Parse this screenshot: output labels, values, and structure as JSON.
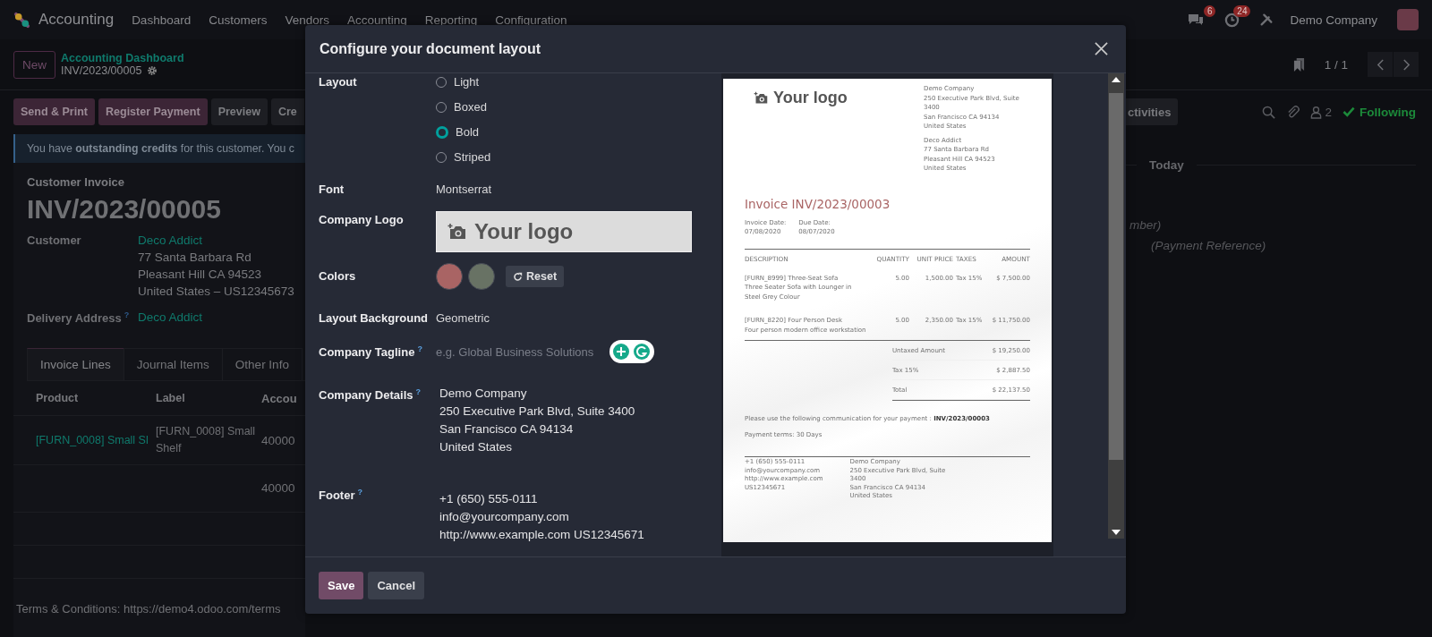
{
  "navbar": {
    "app_name": "Accounting",
    "menu": [
      "Dashboard",
      "Customers",
      "Vendors",
      "Accounting",
      "Reporting",
      "Configuration"
    ],
    "messages_badge": "6",
    "activities_badge": "24",
    "company": "Demo Company"
  },
  "control_panel": {
    "new_button": "New",
    "breadcrumb": "Accounting Dashboard",
    "record": "INV/2023/00005",
    "pager": "1 / 1"
  },
  "actions": {
    "buttons": [
      {
        "label": "Send & Print",
        "kind": "primary"
      },
      {
        "label": "Register Payment",
        "kind": "primary"
      },
      {
        "label": "Preview",
        "kind": "secondary"
      },
      {
        "label": "Cre",
        "kind": "secondary"
      }
    ]
  },
  "alert": "You have **outstanding credits** for this customer. You c",
  "form": {
    "type_label": "Customer Invoice",
    "number": "INV/2023/00005",
    "customer_label": "Customer",
    "customer": "Deco Addict",
    "address": [
      "77 Santa Barbara Rd",
      "Pleasant Hill CA 94523",
      "United States – US12345673"
    ],
    "delivery_label": "Delivery Address",
    "delivery_help": "?",
    "delivery": "Deco Addict",
    "tabs": [
      {
        "label": "Invoice Lines",
        "selected": true
      },
      {
        "label": "Journal Items",
        "selected": false
      },
      {
        "label": "Other Info",
        "selected": false
      }
    ],
    "table": {
      "columns": [
        "Product",
        "Label",
        "Accou"
      ],
      "rows": [
        {
          "product": "[FURN_0008] Small Sl",
          "label": "[FURN_0008] Small Shelf",
          "account": "40000"
        },
        {
          "account": "40000"
        }
      ]
    },
    "terms": "Terms & Conditions: https://demo4.odoo.com/terms"
  },
  "chatter": {
    "activities_button": "ctivities",
    "followers": "2",
    "following": "Following",
    "date_divider": "Today",
    "messages": [
      "mber)",
      "(Payment Reference)"
    ]
  },
  "dialog": {
    "title": "Configure your document layout",
    "layout": {
      "label": "Layout",
      "options": [
        {
          "label": "Light",
          "selected": false
        },
        {
          "label": "Boxed",
          "selected": false
        },
        {
          "label": "Bold",
          "selected": true
        },
        {
          "label": "Striped",
          "selected": false
        }
      ]
    },
    "font": {
      "label": "Font",
      "value": "Montserrat"
    },
    "logo": {
      "label": "Company Logo",
      "text": "Your logo"
    },
    "colors": {
      "label": "Colors",
      "swatches": [
        {
          "color": "#a96464"
        },
        {
          "color": "#687264"
        }
      ],
      "reset": "Reset"
    },
    "background": {
      "label": "Layout Background",
      "value": "Geometric"
    },
    "tagline": {
      "label": "Company Tagline",
      "help": "?",
      "placeholder": "e.g. Global Business Solutions"
    },
    "details": {
      "label": "Company Details",
      "help": "?",
      "lines": [
        "Demo Company",
        "250 Executive Park Blvd, Suite 3400",
        "San Francisco CA 94134",
        "United States"
      ]
    },
    "footer": {
      "label": "Footer",
      "help": "?",
      "lines": [
        "+1 (650) 555-0111",
        "info@yourcompany.com",
        "http://www.example.com US12345671"
      ]
    },
    "save": "Save",
    "cancel": "Cancel",
    "preview": {
      "logo": "Your logo",
      "company": [
        "Demo Company",
        "250 Executive Park Blvd, Suite",
        "3400",
        "San Francisco CA 94134",
        "United States"
      ],
      "customer": [
        "Deco Addict",
        "77 Santa Barbara Rd",
        "Pleasant Hill CA 94523",
        "United States"
      ],
      "title": "Invoice INV/2023/00003",
      "dates": [
        {
          "label": "Invoice Date:",
          "value": "07/08/2020"
        },
        {
          "label": "Due Date:",
          "value": "08/07/2020"
        }
      ],
      "columns": [
        "DESCRIPTION",
        "QUANTITY",
        "UNIT PRICE",
        "TAXES",
        "AMOUNT"
      ],
      "lines": [
        {
          "name": "[FURN_8999] Three-Seat Sofa",
          "description": "Three Seater Sofa with Lounger in Steel Grey Colour",
          "quantity": "5.00",
          "price": "1,500.00",
          "taxes": "Tax 15%",
          "amount": "$ 7,500.00"
        },
        {
          "name": "[FURN_8220] Four Person Desk",
          "description": "Four person modern office workstation",
          "quantity": "5.00",
          "price": "2,350.00",
          "taxes": "Tax 15%",
          "amount": "$ 11,750.00"
        }
      ],
      "totals": [
        {
          "label": "Untaxed Amount",
          "value": "$ 19,250.00"
        },
        {
          "label": "Tax 15%",
          "value": "$ 2,887.50"
        },
        {
          "label": "Total",
          "value": "$ 22,137.50"
        }
      ],
      "communication": "Please use the following communication for your payment : **INV/2023/00003**",
      "payment_terms": "Payment terms: 30 Days",
      "footer_contact": [
        "+1 (650) 555-0111",
        "info@yourcompany.com",
        "http://www.example.com",
        "US12345671"
      ],
      "footer_company": [
        "Demo Company",
        "250 Executive Park Blvd, Suite",
        "3400",
        "San Francisco CA 94134",
        "United States"
      ]
    }
  }
}
